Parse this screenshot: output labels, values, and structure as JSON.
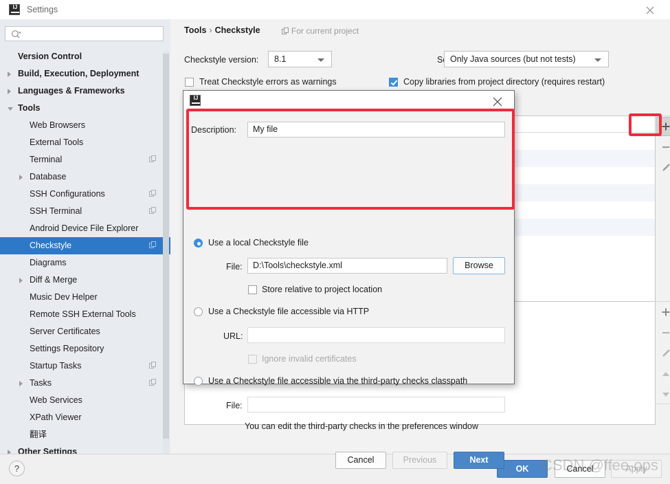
{
  "window": {
    "title": "Settings",
    "logo_text": "IJ",
    "close_icon": "close-icon"
  },
  "search": {
    "value": "",
    "placeholder": "",
    "icon": "search-icon"
  },
  "sidebar": {
    "items": [
      {
        "label": "Version Control",
        "indent": 26,
        "bold": true,
        "twisty": "none",
        "badge": false
      },
      {
        "label": "Build, Execution, Deployment",
        "indent": 26,
        "bold": true,
        "twisty": "closed",
        "badge": false
      },
      {
        "label": "Languages & Frameworks",
        "indent": 26,
        "bold": true,
        "twisty": "closed",
        "badge": false
      },
      {
        "label": "Tools",
        "indent": 26,
        "bold": true,
        "twisty": "open",
        "badge": false
      },
      {
        "label": "Web Browsers",
        "indent": 43,
        "bold": false,
        "twisty": "none",
        "badge": false
      },
      {
        "label": "External Tools",
        "indent": 43,
        "bold": false,
        "twisty": "none",
        "badge": false
      },
      {
        "label": "Terminal",
        "indent": 43,
        "bold": false,
        "twisty": "none",
        "badge": true
      },
      {
        "label": "Database",
        "indent": 43,
        "bold": false,
        "twisty": "closed",
        "badge": false
      },
      {
        "label": "SSH Configurations",
        "indent": 43,
        "bold": false,
        "twisty": "none",
        "badge": true
      },
      {
        "label": "SSH Terminal",
        "indent": 43,
        "bold": false,
        "twisty": "none",
        "badge": true
      },
      {
        "label": "Android Device File Explorer",
        "indent": 43,
        "bold": false,
        "twisty": "none",
        "badge": false
      },
      {
        "label": "Checkstyle",
        "indent": 43,
        "bold": false,
        "twisty": "none",
        "badge": true,
        "selected": true
      },
      {
        "label": "Diagrams",
        "indent": 43,
        "bold": false,
        "twisty": "none",
        "badge": false
      },
      {
        "label": "Diff & Merge",
        "indent": 43,
        "bold": false,
        "twisty": "closed",
        "badge": false
      },
      {
        "label": "Music Dev Helper",
        "indent": 43,
        "bold": false,
        "twisty": "none",
        "badge": false
      },
      {
        "label": "Remote SSH External Tools",
        "indent": 43,
        "bold": false,
        "twisty": "none",
        "badge": false
      },
      {
        "label": "Server Certificates",
        "indent": 43,
        "bold": false,
        "twisty": "none",
        "badge": false
      },
      {
        "label": "Settings Repository",
        "indent": 43,
        "bold": false,
        "twisty": "none",
        "badge": false
      },
      {
        "label": "Startup Tasks",
        "indent": 43,
        "bold": false,
        "twisty": "none",
        "badge": true
      },
      {
        "label": "Tasks",
        "indent": 43,
        "bold": false,
        "twisty": "closed",
        "badge": true
      },
      {
        "label": "Web Services",
        "indent": 43,
        "bold": false,
        "twisty": "none",
        "badge": false
      },
      {
        "label": "XPath Viewer",
        "indent": 43,
        "bold": false,
        "twisty": "none",
        "badge": false
      },
      {
        "label": "翻译",
        "indent": 43,
        "bold": false,
        "twisty": "none",
        "badge": false
      },
      {
        "label": "Other Settings",
        "indent": 26,
        "bold": true,
        "twisty": "closed",
        "badge": false
      }
    ]
  },
  "content": {
    "breadcrumb_parent": "Tools",
    "breadcrumb_sep": "›",
    "breadcrumb_current": "Checkstyle",
    "for_current_project": "For current project",
    "version_label": "Checkstyle version:",
    "version_value": "8.1",
    "scan_scope_label": "Scan Scope:",
    "scan_scope_value": "Only Java sources (but not tests)",
    "treat_errors_label": "Treat Checkstyle errors as warnings",
    "treat_errors_checked": false,
    "copy_libraries_label": "Copy libraries from project directory (requires restart)",
    "copy_libraries_checked": true,
    "toolbar_icons": [
      "plus-icon",
      "minus-icon",
      "pencil-icon"
    ],
    "toolbar2_icons": [
      "plus-icon",
      "minus-icon",
      "pencil-icon",
      "move-up-icon",
      "move-down-icon"
    ]
  },
  "dialog": {
    "logo_text": "IJ",
    "close_icon": "close-icon",
    "description_label": "Description:",
    "description_value": "My file",
    "option_local_label": "Use a local Checkstyle file",
    "option_local_selected": true,
    "local_file_label": "File:",
    "local_file_value": "D:\\Tools\\checkstyle.xml",
    "browse_label": "Browse",
    "store_relative_label": "Store relative to project location",
    "store_relative_checked": false,
    "option_http_label": "Use a Checkstyle file accessible via HTTP",
    "option_http_selected": false,
    "url_label": "URL:",
    "url_value": "",
    "ignore_certs_label": "Ignore invalid certificates",
    "ignore_certs_checked": false,
    "option_classpath_label": "Use a Checkstyle file accessible via the third-party checks classpath",
    "option_classpath_selected": false,
    "classpath_file_label": "File:",
    "classpath_file_value": "",
    "hint": "You can edit the third-party checks in the preferences window",
    "cancel_label": "Cancel",
    "previous_label": "Previous",
    "next_label": "Next"
  },
  "footer": {
    "help_label": "?",
    "ok_label": "OK",
    "cancel_label": "Cancel",
    "apply_label": "Apply"
  },
  "watermark": {
    "text": "CSDN @ffee-ops"
  },
  "colors": {
    "accent": "#2e78c8",
    "primary_button": "#4a86c8",
    "annotation_red": "#ef2c3c",
    "checkbox_checked": "#3c8ede",
    "sidebar_bg": "#e8ecf0"
  }
}
